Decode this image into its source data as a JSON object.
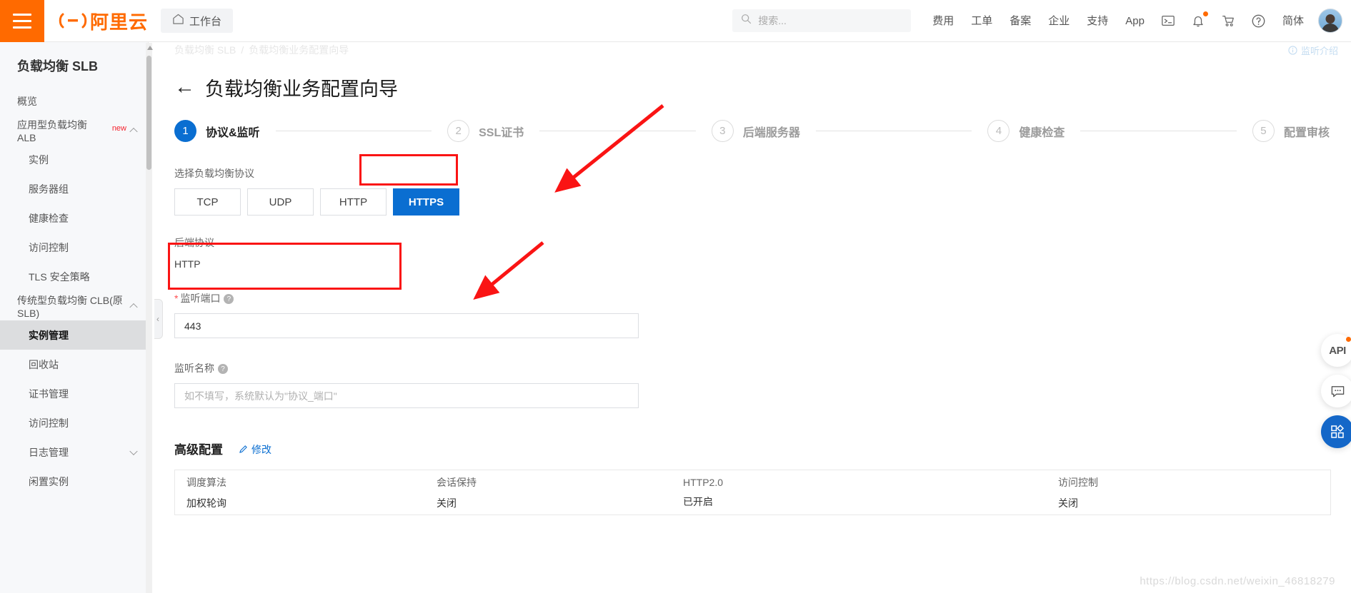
{
  "topbar": {
    "menu_icon": "hamburger-icon",
    "brand": "阿里云",
    "workbench": "工作台",
    "search_placeholder": "搜索...",
    "nav_items": [
      "费用",
      "工单",
      "备案",
      "企业",
      "支持",
      "App"
    ],
    "icons": [
      "terminal-icon",
      "bell-icon",
      "cart-icon",
      "help-icon"
    ],
    "language": "简体",
    "accent_color": "#ff6a00"
  },
  "sidebar": {
    "title": "负载均衡 SLB",
    "items": [
      {
        "label": "概览",
        "level": "top",
        "active": false,
        "chevron": ""
      },
      {
        "label": "应用型负载均衡 ALB",
        "badge": "new",
        "level": "top",
        "active": false,
        "chevron": "up"
      },
      {
        "label": "实例",
        "level": "sub",
        "active": false,
        "chevron": ""
      },
      {
        "label": "服务器组",
        "level": "sub",
        "active": false,
        "chevron": ""
      },
      {
        "label": "健康检查",
        "level": "sub",
        "active": false,
        "chevron": ""
      },
      {
        "label": "访问控制",
        "level": "sub",
        "active": false,
        "chevron": ""
      },
      {
        "label": "TLS 安全策略",
        "level": "sub",
        "active": false,
        "chevron": ""
      },
      {
        "label": "传统型负载均衡 CLB(原SLB)",
        "level": "top",
        "active": false,
        "chevron": "up"
      },
      {
        "label": "实例管理",
        "level": "sub",
        "active": true,
        "chevron": ""
      },
      {
        "label": "回收站",
        "level": "sub",
        "active": false,
        "chevron": ""
      },
      {
        "label": "证书管理",
        "level": "sub",
        "active": false,
        "chevron": ""
      },
      {
        "label": "访问控制",
        "level": "sub",
        "active": false,
        "chevron": ""
      },
      {
        "label": "日志管理",
        "level": "sub",
        "active": false,
        "chevron": "down"
      },
      {
        "label": "闲置实例",
        "level": "sub",
        "active": false,
        "chevron": ""
      }
    ]
  },
  "main": {
    "breadcrumb": [
      "负载均衡 SLB",
      "负载均衡业务配置向导"
    ],
    "breadcrumb_sep": "/",
    "monitor_intro": "监听介绍",
    "page_title": "负载均衡业务配置向导",
    "back_icon": "back-arrow-icon",
    "steps": [
      {
        "num": "1",
        "label": "协议&监听",
        "active": true
      },
      {
        "num": "2",
        "label": "SSL证书",
        "active": false
      },
      {
        "num": "3",
        "label": "后端服务器",
        "active": false
      },
      {
        "num": "4",
        "label": "健康检查",
        "active": false
      },
      {
        "num": "5",
        "label": "配置审核",
        "active": false
      }
    ],
    "protocol_section": {
      "label": "选择负载均衡协议",
      "options": [
        "TCP",
        "UDP",
        "HTTP",
        "HTTPS"
      ],
      "selected": "HTTPS"
    },
    "backend_protocol": {
      "label": "后端协议",
      "value": "HTTP"
    },
    "listen_port": {
      "label": "监听端口",
      "required": true,
      "help": "?",
      "value": "443"
    },
    "listener_name": {
      "label": "监听名称",
      "help": "?",
      "value": "",
      "placeholder": "如不填写，系统默认为\"协议_端口\""
    },
    "advanced": {
      "title": "高级配置",
      "edit_label": "修改",
      "edit_icon": "pencil-icon",
      "fields": [
        {
          "key": "调度算法",
          "value": "加权轮询"
        },
        {
          "key": "会话保持",
          "value": "关闭"
        },
        {
          "key": "HTTP2.0",
          "value": "已开启"
        },
        {
          "key": "访问控制",
          "value": "关闭"
        }
      ]
    },
    "collapse_handle": "‹"
  },
  "float_buttons": [
    {
      "name": "api-button",
      "label": "API",
      "style": "light",
      "dot": true
    },
    {
      "name": "feedback-button",
      "label": "",
      "style": "light",
      "dot": false
    },
    {
      "name": "apps-button",
      "label": "",
      "style": "blue",
      "dot": false
    }
  ],
  "watermark": "https://blog.csdn.net/weixin_46818279",
  "annotations": {
    "highlight_color": "#fa1414",
    "boxes": [
      "protocol-https-button",
      "listen-port-field"
    ],
    "arrows": 2
  }
}
